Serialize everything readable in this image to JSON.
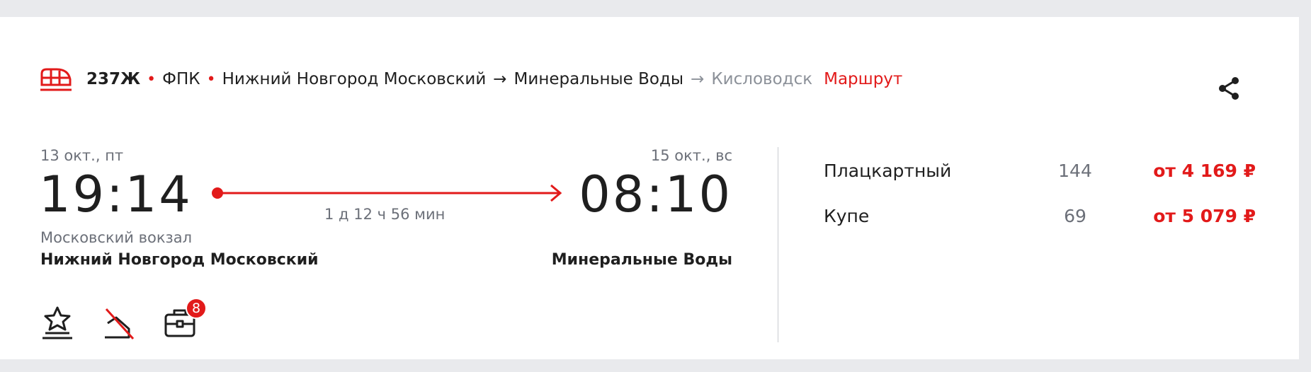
{
  "header": {
    "train_icon": "train-icon",
    "train_number": "237Ж",
    "carrier": "ФПК",
    "from": "Нижний Новгород Московский",
    "to": "Минеральные Воды",
    "final_destination": "Кисловодск",
    "route_link": "Маршрут",
    "share_icon": "share-icon"
  },
  "departure": {
    "date": "13 окт., пт",
    "time": "19:14",
    "station": "Московский вокзал",
    "city": "Нижний Новгород Московский"
  },
  "arrival": {
    "date": "15 окт., вс",
    "time": "08:10",
    "city": "Минеральные Воды"
  },
  "duration": "1 д 12 ч 56 мин",
  "features": [
    {
      "icon": "star-podium-icon"
    },
    {
      "icon": "no-return-icon"
    },
    {
      "icon": "luggage-icon",
      "badge": "8"
    }
  ],
  "prices": [
    {
      "class": "Плацкартный",
      "seats": "144",
      "price": "от 4 169 ₽"
    },
    {
      "class": "Купе",
      "seats": "69",
      "price": "от 5 079 ₽"
    }
  ],
  "colors": {
    "accent": "#e21a1a",
    "muted": "#8c9199",
    "text": "#1f1f1f",
    "background": "#e9eaed"
  }
}
